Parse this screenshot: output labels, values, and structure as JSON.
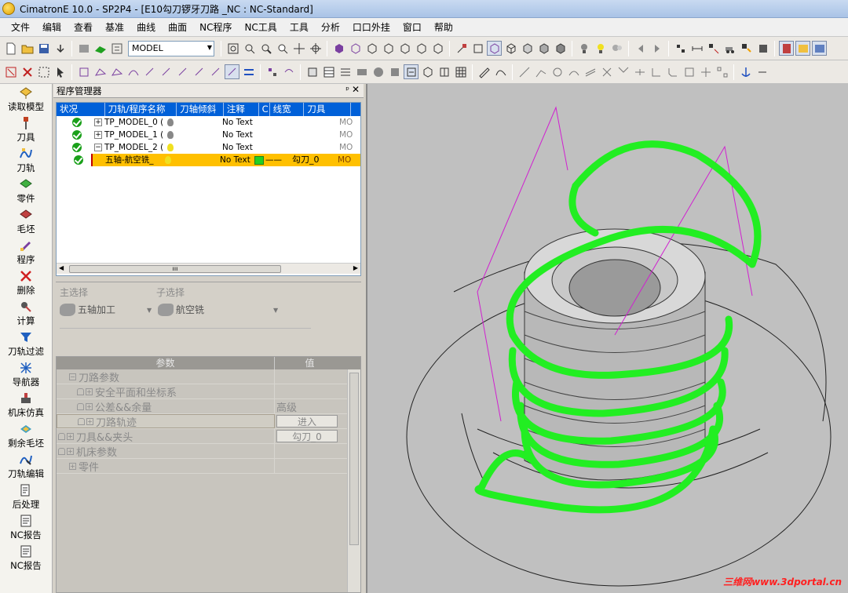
{
  "window": {
    "title": "CimatronE 10.0 - SP2P4 - [E10勾刀锣牙刀路 _NC : NC-Standard]"
  },
  "menu": {
    "items": [
      "文件",
      "编辑",
      "查看",
      "基准",
      "曲线",
      "曲面",
      "NC程序",
      "NC工具",
      "工具",
      "分析",
      "口口外挂",
      "窗口",
      "帮助"
    ]
  },
  "toolbar": {
    "model_combo": "MODEL"
  },
  "sidebar": {
    "items": [
      {
        "label": "读取模型",
        "icon": "load-model-icon"
      },
      {
        "label": "刀具",
        "icon": "tool-icon"
      },
      {
        "label": "刀轨",
        "icon": "toolpath-icon"
      },
      {
        "label": "零件",
        "icon": "part-icon"
      },
      {
        "label": "毛坯",
        "icon": "stock-icon"
      },
      {
        "label": "程序",
        "icon": "program-icon"
      },
      {
        "label": "删除",
        "icon": "delete-icon"
      },
      {
        "label": "计算",
        "icon": "calculate-icon"
      },
      {
        "label": "刀轨过滤",
        "icon": "filter-icon"
      },
      {
        "label": "导航器",
        "icon": "navigator-icon"
      },
      {
        "label": "机床仿真",
        "icon": "machine-sim-icon"
      },
      {
        "label": "剩余毛坯",
        "icon": "remaining-stock-icon"
      },
      {
        "label": "刀轨编辑",
        "icon": "toolpath-edit-icon"
      },
      {
        "label": "后处理",
        "icon": "post-process-icon"
      },
      {
        "label": "NC报告",
        "icon": "nc-report-icon"
      },
      {
        "label": "NC报告",
        "icon": "nc-report-icon"
      }
    ]
  },
  "program_manager": {
    "title": "程序管理器",
    "pin": "ᵖ",
    "close": "✕",
    "columns": [
      "状况",
      "刀轨/程序名称",
      "刀轴倾斜",
      "注释",
      "C",
      "线宽",
      "刀具"
    ],
    "rows": [
      {
        "name": "TP_MODEL_0 (",
        "note": "No Text",
        "mo": "MO",
        "expander": "+"
      },
      {
        "name": "TP_MODEL_1 (",
        "note": "No Text",
        "mo": "MO",
        "expander": "+"
      },
      {
        "name": "TP_MODEL_2 (",
        "note": "No Text",
        "mo": "MO",
        "expander": "−"
      },
      {
        "name": "五轴-航空铣_",
        "note": "No Text",
        "line": "——",
        "tool": "勾刀_0",
        "mo": "MO",
        "selected": true
      }
    ]
  },
  "selection": {
    "main_label": "主选择",
    "main_value": "五轴加工",
    "sub_label": "子选择",
    "sub_value": "航空铣"
  },
  "params": {
    "header_name": "参数",
    "header_value": "值",
    "rows": [
      {
        "name": "刀路参数",
        "value": ""
      },
      {
        "name": "安全平面和坐标系",
        "value": ""
      },
      {
        "name": "公差&&余量",
        "value": "高级"
      },
      {
        "name": "刀路轨迹",
        "value": "进入"
      },
      {
        "name": "刀具&&夹头",
        "value": "勾刀_0"
      },
      {
        "name": "机床参数",
        "value": ""
      },
      {
        "name": "零件",
        "value": ""
      }
    ]
  },
  "watermark": "三维网www.3dportal.cn",
  "colors": {
    "toolpath_green": "#22ee22",
    "link_magenta": "#d020d0",
    "selected_row": "#ffc000",
    "tree_header": "#0060d8"
  }
}
